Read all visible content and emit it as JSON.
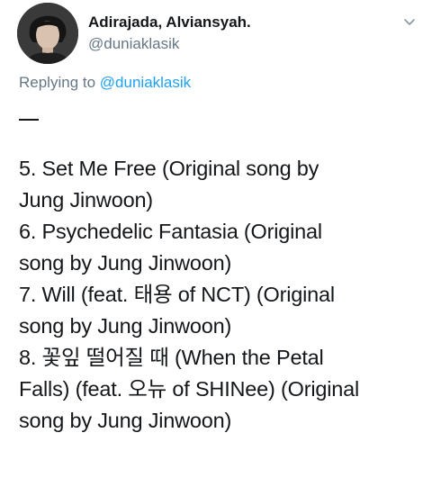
{
  "tweet": {
    "author": {
      "display_name": "Adirajada, Alviansyah.",
      "handle": "@duniaklasik",
      "avatar_icon": "profile-photo"
    },
    "menu_icon": "chevron-down-icon",
    "reply": {
      "prefix": "Replying to",
      "target": "@duniaklasik"
    },
    "body": {
      "separator": "—",
      "lines": [
        "5. Set Me Free (Original song by",
        "Jung Jinwoon)",
        "6. Psychedelic Fantasia (Original",
        "song by Jung Jinwoon)",
        "7. Will (feat. 태용 of NCT) (Original",
        "song by Jung Jinwoon)",
        "8. 꽃잎 떨어질 때 (When the Petal",
        "Falls) (feat. 오뉴 of SHINee) (Original",
        "song by Jung Jinwoon)"
      ]
    }
  },
  "colors": {
    "text": "#14171a",
    "secondary": "#657786",
    "link": "#1da1f2",
    "chevron": "#8899a6"
  }
}
